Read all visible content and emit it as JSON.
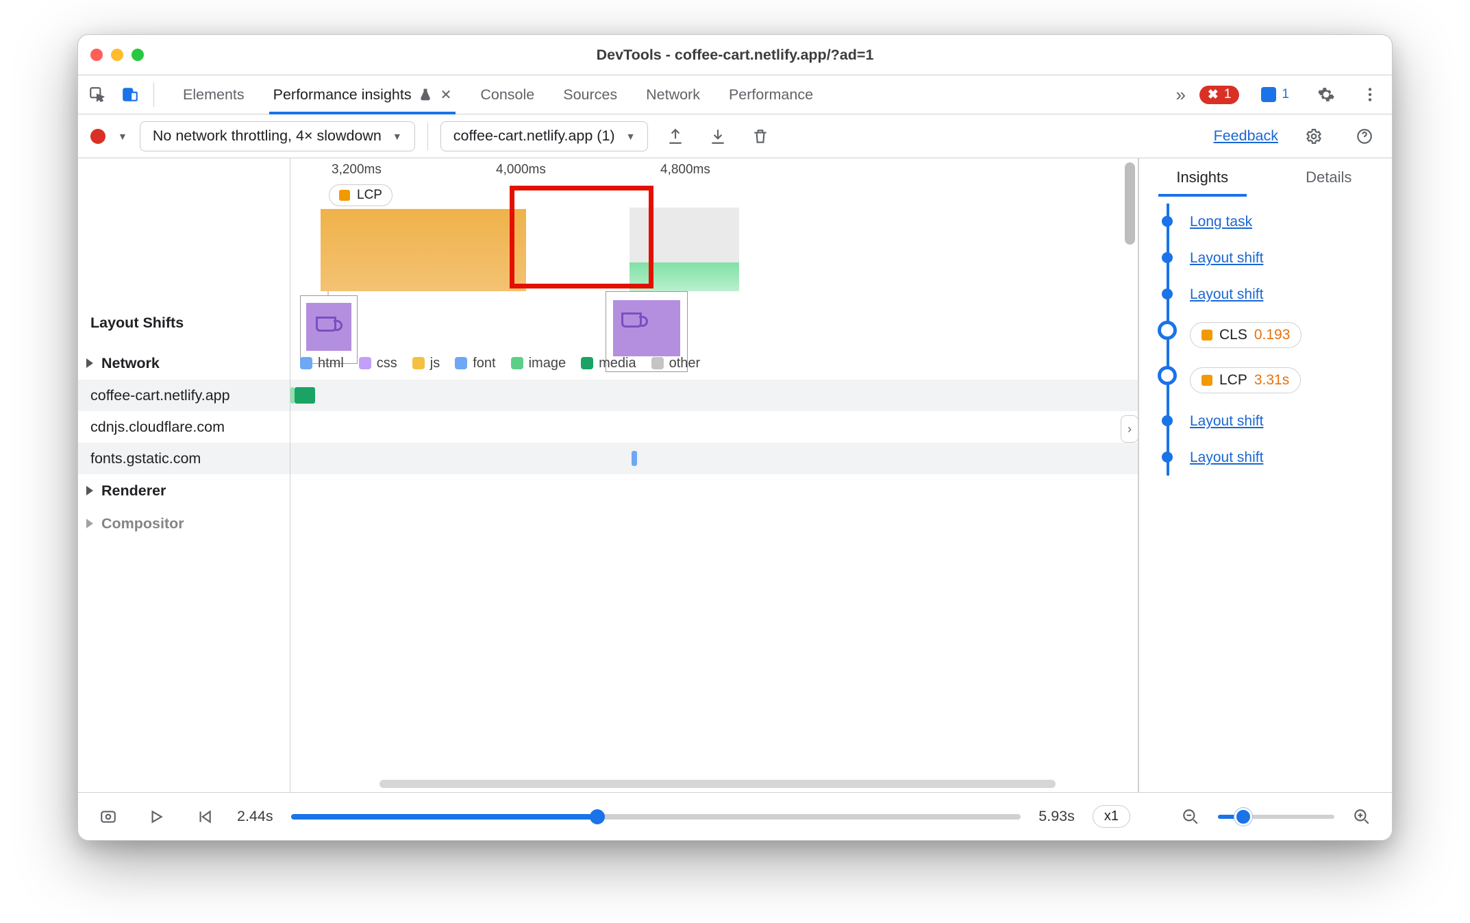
{
  "window": {
    "title": "DevTools - coffee-cart.netlify.app/?ad=1"
  },
  "devtools_tabs": {
    "items": [
      "Elements",
      "Performance insights",
      "Console",
      "Sources",
      "Network",
      "Performance"
    ],
    "active_index": 1,
    "more_glyph": "»",
    "errors_count": "1",
    "messages_count": "1"
  },
  "toolbar": {
    "throttle": "No network throttling, 4× slowdown",
    "recording_select": "coffee-cart.netlify.app (1)",
    "feedback": "Feedback"
  },
  "timeline": {
    "ticks": [
      "3,200ms",
      "4,000ms",
      "4,800ms"
    ],
    "lcp_badge": "LCP",
    "tracks": {
      "layout_shifts_label": "Layout Shifts",
      "network_label": "Network",
      "renderer_label": "Renderer",
      "compositor_label": "Compositor",
      "network_legend": [
        {
          "label": "html",
          "color": "#6ea7f4"
        },
        {
          "label": "css",
          "color": "#c29ffa"
        },
        {
          "label": "js",
          "color": "#f5bf42"
        },
        {
          "label": "font",
          "color": "#6ea7f4"
        },
        {
          "label": "image",
          "color": "#5bcf87"
        },
        {
          "label": "media",
          "color": "#1aa363"
        },
        {
          "label": "other",
          "color": "#c4c4c4"
        }
      ],
      "network_rows": [
        "coffee-cart.netlify.app",
        "cdnjs.cloudflare.com",
        "fonts.gstatic.com"
      ]
    }
  },
  "right_panel": {
    "tabs": [
      "Insights",
      "Details"
    ],
    "active_index": 0,
    "items": [
      {
        "type": "link",
        "label": "Long task"
      },
      {
        "type": "link",
        "label": "Layout shift"
      },
      {
        "type": "link",
        "label": "Layout shift"
      },
      {
        "type": "metric",
        "name": "CLS",
        "value": "0.193",
        "color": "#f29900"
      },
      {
        "type": "metric",
        "name": "LCP",
        "value": "3.31s",
        "color": "#f29900"
      },
      {
        "type": "link",
        "label": "Layout shift"
      },
      {
        "type": "link",
        "label": "Layout shift"
      }
    ]
  },
  "footer": {
    "start": "2.44s",
    "end": "5.93s",
    "speed": "x1"
  }
}
